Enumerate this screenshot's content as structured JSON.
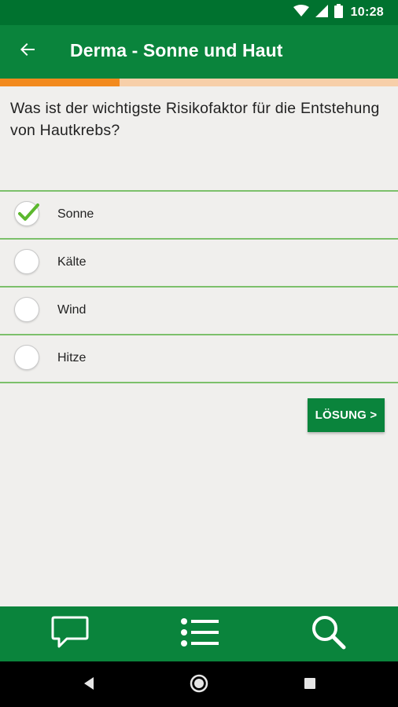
{
  "status_bar": {
    "time": "10:28",
    "icons": [
      "wifi-icon",
      "signal-icon",
      "battery-icon"
    ]
  },
  "app_bar": {
    "title": "Derma - Sonne und Haut",
    "back_icon": "arrow-left-icon"
  },
  "progress": {
    "fraction": 0.3
  },
  "question": {
    "text": "Was ist der wichtigste Risikofaktor für die Entstehung von Hautkrebs?"
  },
  "answers": [
    {
      "label": "Sonne",
      "selected": true
    },
    {
      "label": "Kälte",
      "selected": false
    },
    {
      "label": "Wind",
      "selected": false
    },
    {
      "label": "Hitze",
      "selected": false
    }
  ],
  "solution_button": {
    "label": "LÖSUNG >"
  },
  "bottom_nav": {
    "items": [
      "chat-icon",
      "list-icon",
      "search-icon"
    ]
  },
  "system_nav": {
    "items": [
      "back-triangle-icon",
      "home-circle-icon",
      "recents-square-icon"
    ]
  },
  "colors": {
    "status_bar": "#00722f",
    "primary": "#0a843c",
    "accent_orange": "#f28a1e",
    "progress_track": "#f7cfa9",
    "divider": "#7cc06b",
    "check": "#5cb82e",
    "background": "#f0efed"
  }
}
